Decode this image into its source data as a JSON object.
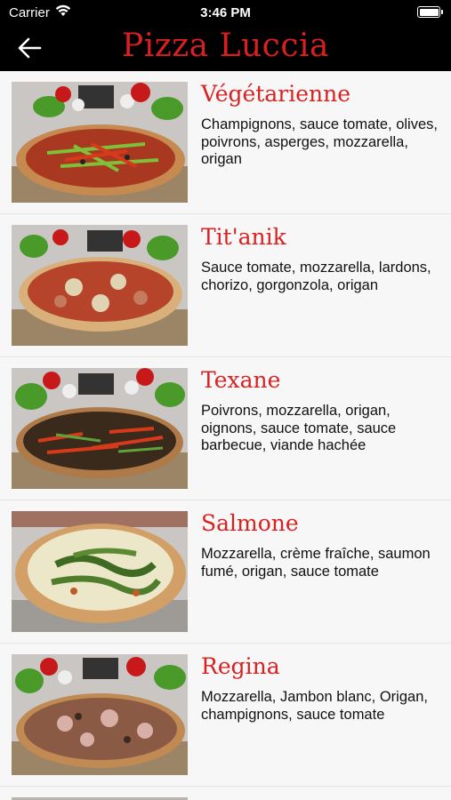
{
  "status_bar": {
    "carrier": "Carrier",
    "time": "3:46 PM"
  },
  "nav": {
    "title": "Pizza Luccia",
    "back_icon": "arrow-left-icon"
  },
  "colors": {
    "title_red": "#d91f1f",
    "name_red": "#d92121",
    "bar_black": "#000000"
  },
  "pizzas": [
    {
      "name": "Végétarienne",
      "description": "Champignons, sauce tomate, olives, poivrons, asperges, mozzarella, origan"
    },
    {
      "name": "Tit'anik",
      "description": "Sauce tomate, mozzarella, lardons, chorizo, gorgonzola, origan"
    },
    {
      "name": "Texane",
      "description": "Poivrons, mozzarella, origan, oignons, sauce tomate, sauce barbecue, viande hachée"
    },
    {
      "name": "Salmone",
      "description": "Mozzarella, crème fraîche, saumon fumé, origan, sauce tomate"
    },
    {
      "name": "Regina",
      "description": "Mozzarella, Jambon blanc, Origan, champignons, sauce tomate"
    }
  ]
}
